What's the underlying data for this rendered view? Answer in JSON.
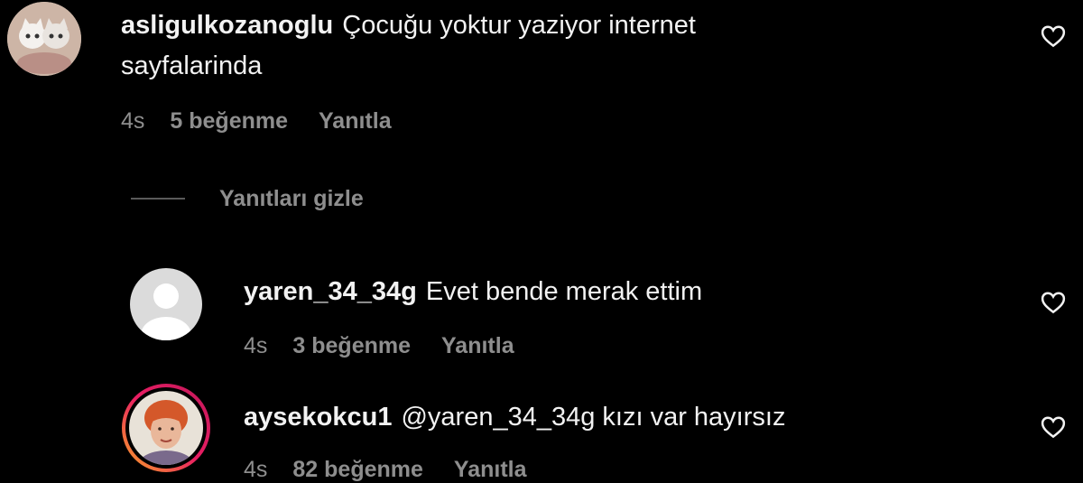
{
  "comments": [
    {
      "username": "asligulkozanoglu",
      "text_line1": "Çocuğu yoktur yaziyor internet",
      "text_line2": "sayfalarinda",
      "time": "4s",
      "likes": "5 beğenme",
      "reply": "Yanıtla",
      "avatar": "cat-avatar-icon"
    },
    {
      "username": "yaren_34_34g",
      "text_line1": "Evet bende merak ettim",
      "time": "4s",
      "likes": "3 beğenme",
      "reply": "Yanıtla",
      "avatar": "default-avatar-icon"
    },
    {
      "username": "aysekokcu1",
      "text_line1": "@yaren_34_34g kızı var hayırsız",
      "time": "4s",
      "likes": "82 beğenme",
      "reply": "Yanıtla",
      "avatar": "woman-avatar-icon"
    }
  ],
  "replies_toggle": {
    "label": "Yanıtları gizle"
  },
  "colors": {
    "background": "#000000",
    "text": "#f2f2f2",
    "secondary": "#8e8e8e",
    "story_ring_start": "#f9a825",
    "story_ring_end": "#c2185b"
  }
}
